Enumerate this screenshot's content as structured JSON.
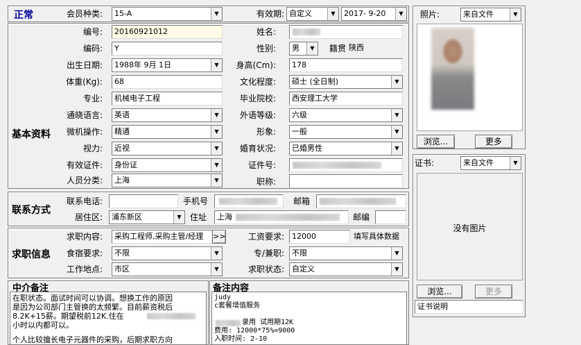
{
  "status_label": "正常",
  "member": {
    "type_label": "会员种类:",
    "type_value": "15-A",
    "validity_label": "有效期:",
    "validity_type": "自定义",
    "validity_date": "2017- 9-20"
  },
  "photo": {
    "label": "照片:",
    "source": "来自文件",
    "browse": "浏览...",
    "more": "更多"
  },
  "basic": {
    "section_label": "基本资料",
    "id_label": "编号:",
    "id_value": "20160921012",
    "name_label": "姓名:",
    "code_label": "编码:",
    "code_value": "Y",
    "gender_label": "性别:",
    "gender_value": "男",
    "native_label": "籍贯",
    "native_value": "陕西",
    "birth_label": "出生日期:",
    "birth_value": "1988年 9月 1日",
    "height_label": "身高(Cm):",
    "height_value": "178",
    "weight_label": "体重(Kg):",
    "weight_value": "68",
    "edu_label": "文化程度:",
    "edu_value": "硕士 (全日制)",
    "major_label": "专业:",
    "major_value": "机械电子工程",
    "school_label": "毕业院校:",
    "school_value": "西安理工大学",
    "lang_label": "通晓语言:",
    "lang_value": "英语",
    "lang_level_label": "外语等级:",
    "lang_level_value": "六级",
    "pc_label": "微机操作:",
    "pc_value": "精通",
    "look_label": "形象:",
    "look_value": "一般",
    "vision_label": "视力:",
    "vision_value": "近视",
    "marital_label": "婚育状况:",
    "marital_value": "已婚男性",
    "doc_label": "有效证件:",
    "doc_value": "身份证",
    "docno_label": "证件号:",
    "category_label": "人员分类:",
    "category_value": "上海",
    "title_label": "职称:"
  },
  "contact": {
    "section_label": "联系方式",
    "phone_label": "联系电话:",
    "mobile_label": "手机号",
    "email_label": "邮箱",
    "area_label": "居住区:",
    "area_value": "浦东新区",
    "address_label": "住址",
    "address_value": "上海",
    "zip_label": "邮编"
  },
  "job": {
    "section_label": "求职信息",
    "content_label": "求职内容:",
    "content_value": "采购工程师,采购主管/经理",
    "more_btn": ">>",
    "salary_label": "工资要求:",
    "salary_value": "12000",
    "salary_hint": "填写具体数据",
    "board_label": "食宿要求:",
    "board_value": "不限",
    "parttime_label": "专/兼职:",
    "parttime_value": "不限",
    "place_label": "工作地点:",
    "place_value": "市区",
    "jobstatus_label": "求职状态:",
    "jobstatus_value": "自定义"
  },
  "cert": {
    "label": "证书:",
    "source": "来自文件",
    "no_image": "没有图片",
    "browse": "浏览...",
    "more": "更多",
    "desc_value": "证书说明"
  },
  "agent_note": {
    "title": "中介备注",
    "line1": "在职状态。面试时间可以协调。想换工作的原因",
    "line2": "是因为公司部门主管换的太频繁。目前薪资税后",
    "line3": "8.2K+15薪。期望税前12K.住在",
    "line4": "小时以内都可以。",
    "line5": "个人比较擅长电子元器件的采购，后期求职方向"
  },
  "remark": {
    "title": "备注内容",
    "line1": "judy",
    "line2": "c套餐增值服务",
    "line3": "录用 试用期12K",
    "line4": "费用: 12000*75%=9000",
    "line5": "入职时间: 2-10"
  }
}
